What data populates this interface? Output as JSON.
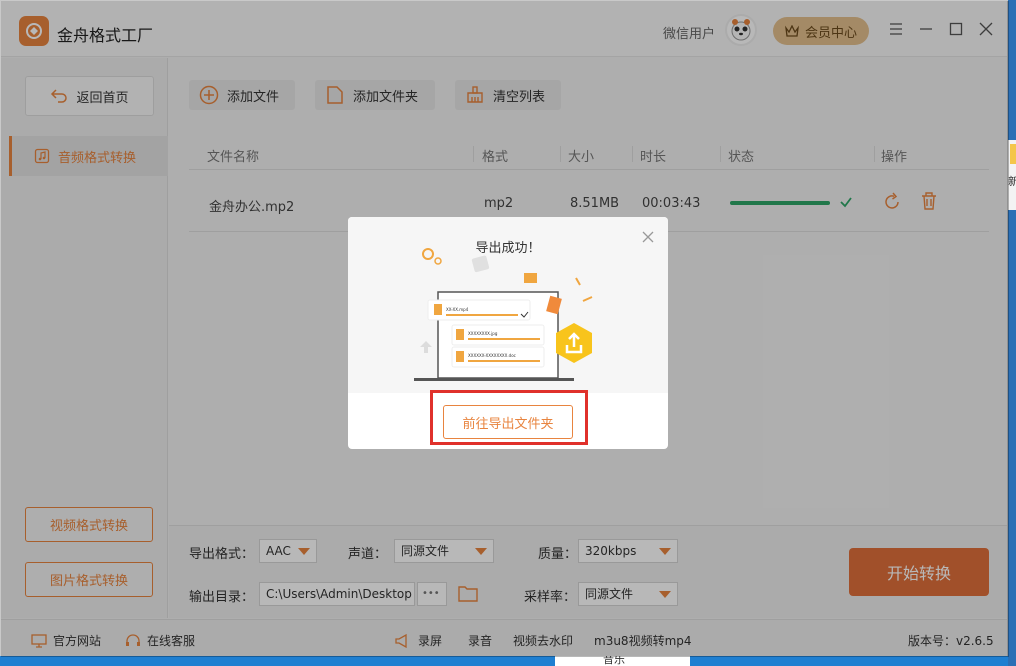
{
  "app": {
    "title": "金舟格式工厂"
  },
  "titlebar": {
    "user_name": "微信用户",
    "vip_label": "会员中心"
  },
  "sidebar": {
    "back_label": "返回首页",
    "active_item": "音频格式转换",
    "video_btn": "视频格式转换",
    "image_btn": "图片格式转换"
  },
  "toolbar": {
    "add_file": "添加文件",
    "add_folder": "添加文件夹",
    "clear_list": "清空列表"
  },
  "table": {
    "headers": [
      "文件名称",
      "格式",
      "大小",
      "时长",
      "状态",
      "操作"
    ],
    "rows": [
      {
        "name": "金舟办公.mp2",
        "format": "mp2",
        "size": "8.51MB",
        "duration": "00:03:43",
        "progress": 1.0
      }
    ]
  },
  "settings": {
    "output_format_label": "导出格式：",
    "output_format_value": "AAC",
    "channel_label": "声道：",
    "channel_value": "同源文件",
    "quality_label": "质量：",
    "quality_value": "320kbps",
    "output_dir_label": "输出目录：",
    "output_dir_value": "C:\\Users\\Admin\\Desktop",
    "dots": "•••",
    "sample_rate_label": "采样率：",
    "sample_rate_value": "同源文件",
    "start_label": "开始转换"
  },
  "footer": {
    "website": "官方网站",
    "support": "在线客服",
    "record_screen": "录屏",
    "record_audio": "录音",
    "remove_watermark": "视频去水印",
    "m3u8": "m3u8视频转mp4",
    "version": "版本号：v2.6.5"
  },
  "modal": {
    "title": "导出成功！",
    "goto_folder": "前往导出文件夹",
    "files": [
      "XX-XX.mp4",
      "XXXXXXXX.jpg",
      "XXXXXX-XXXXXXXX.doc"
    ]
  },
  "desktop": {
    "side_text": "新",
    "side_text2": "x",
    "taskbar_text": "音乐"
  },
  "colors": {
    "accent": "#e8843f",
    "progress": "#2ea567",
    "start": "#e0703b",
    "highlight": "#e0312b"
  }
}
